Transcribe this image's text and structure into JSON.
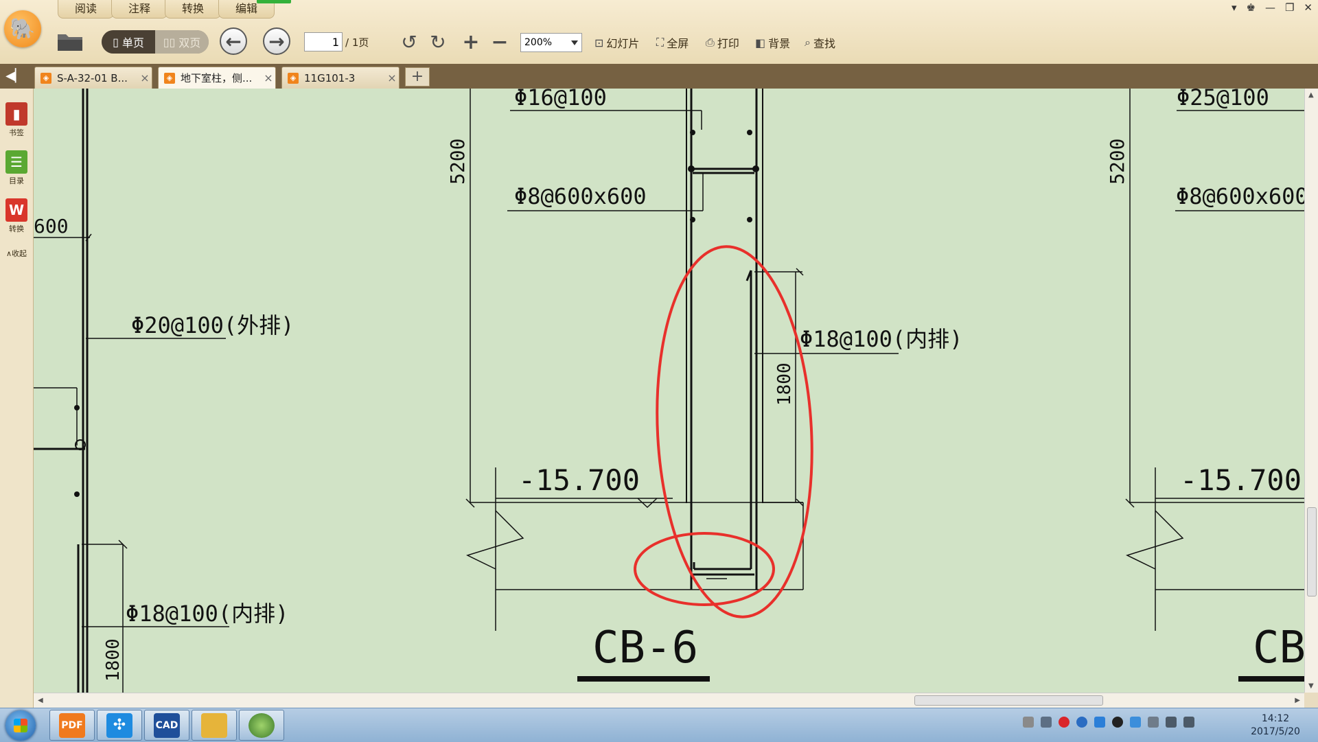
{
  "menu": {
    "tabs": [
      "阅读",
      "注释",
      "转换",
      "编辑"
    ]
  },
  "toolbar": {
    "view_single": "单页",
    "view_double": "双页",
    "page_current": "1",
    "page_total": "/ 1页",
    "zoom": "200%",
    "slideshow": "幻灯片",
    "fullscreen": "全屏",
    "print": "打印",
    "background": "背景",
    "find": "查找"
  },
  "tabs": [
    {
      "label": "S-A-32-01 B...",
      "close": "×"
    },
    {
      "label": "地下室柱，侧...",
      "close": "×"
    },
    {
      "label": "11G101-3",
      "close": "×"
    }
  ],
  "tab_add": "+",
  "sidebar": {
    "items": [
      {
        "label": "书签",
        "icon": "bookmark-icon",
        "color": "#c0392b"
      },
      {
        "label": "目录",
        "icon": "catalog-icon",
        "color": "#5aa832"
      },
      {
        "label": "转换",
        "icon": "convert-icon",
        "color": "#d9362b"
      }
    ],
    "collapse": "∧收起"
  },
  "drawing": {
    "left_col": {
      "dim600": "600",
      "outer": "Φ20@100(外排)",
      "inner": "Φ18@100(内排)",
      "dim1800": "1800"
    },
    "center_col": {
      "top_bar": "Φ16@100",
      "dim5200": "5200",
      "tie": "Φ8@600x600",
      "inner": "Φ18@100(内排)",
      "dim1800": "1800",
      "elev": "-15.700",
      "label": "CB-6"
    },
    "right_col": {
      "top_bar": "Φ25@100",
      "dim5200": "5200",
      "tie": "Φ8@600x600",
      "elev": "-15.700",
      "label": "CB"
    },
    "colors": {
      "background": "#d1e3c6",
      "line": "#111111",
      "annotation": "#e8302b"
    }
  },
  "taskbar": {
    "clock_time": "14:12",
    "clock_date": "2017/5/20",
    "apps": [
      {
        "icon": "pdf-reader-icon",
        "color": "#f07a1e",
        "text": "PDF"
      },
      {
        "icon": "pinwheel-icon",
        "color": "#1e8be0",
        "text": "✣"
      },
      {
        "icon": "cad-icon",
        "color": "#1f4f9a",
        "text": "CAD"
      },
      {
        "icon": "folder-icon",
        "color": "#e6b43a",
        "text": ""
      },
      {
        "icon": "globe-icon",
        "color": "#5a8f3c",
        "text": ""
      }
    ]
  }
}
